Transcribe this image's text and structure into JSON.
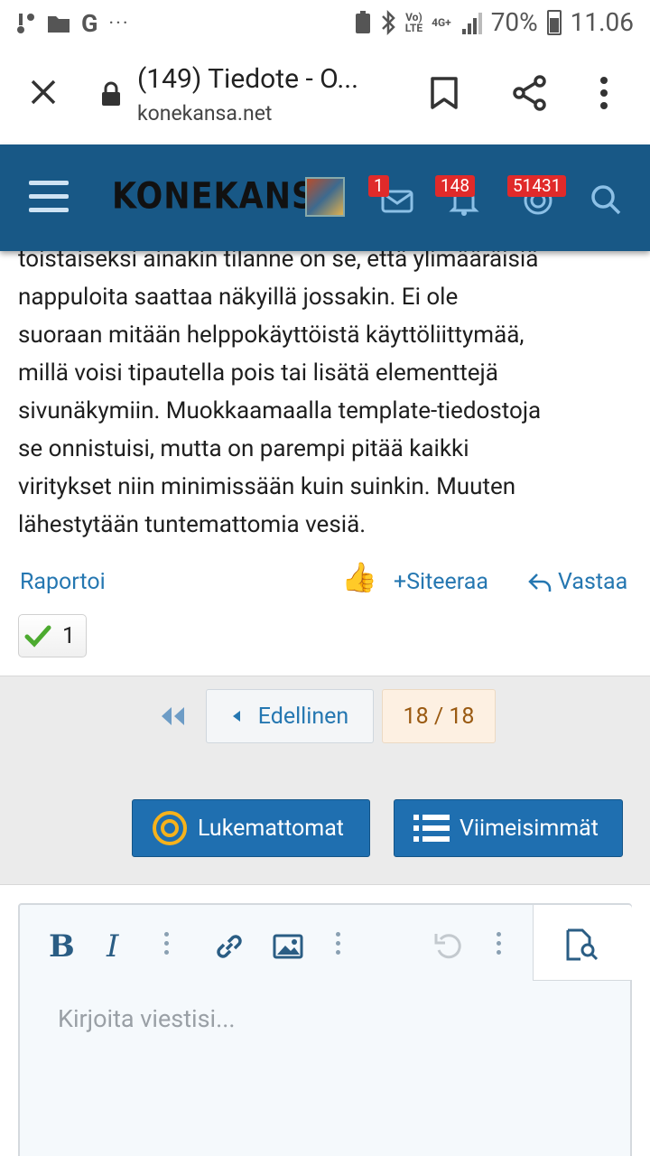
{
  "status_bar": {
    "battery": "70%",
    "time": "11.06",
    "signal_label_top": "Vo)",
    "signal_label_bottom": "LTE",
    "network": "4G+"
  },
  "browser": {
    "tab_title": "(149) Tiedote - O...",
    "url": "konekansa.net"
  },
  "header": {
    "logo": "KONEKANSA",
    "messages_badge": "1",
    "alerts_badge": "148",
    "unread_badge": "51431"
  },
  "post": {
    "partial_top_line": "toistaiseksi ainakin tilanne on se, että ylimääräisiä",
    "lines": [
      "nappuloita saattaa näkyillä jossakin. Ei ole",
      "suoraan mitään helppokäyttöistä käyttöliittymää,",
      "millä voisi tipautella pois tai lisätä elementtejä",
      "sivunäkymiin. Muokkaamaalla template-tiedostoja",
      "se onnistuisi, mutta on parempi pitää kaikki",
      "viritykset niin minimissään kuin suinkin. Muuten",
      "lähestytään tuntemattomia vesiä."
    ],
    "report_label": "Raportoi",
    "quote_label": "Siteeraa",
    "reply_label": "Vastaa",
    "reaction_count": "1"
  },
  "pagination": {
    "prev_label": "Edellinen",
    "current": "18 / 18"
  },
  "buttons": {
    "unread_label": "Lukemattomat",
    "latest_label": "Viimeisimmät"
  },
  "editor": {
    "placeholder": "Kirjoita viestisi...",
    "bold": "B",
    "italic": "I"
  },
  "colors": {
    "header_bg": "#185886",
    "link": "#2577b1",
    "badge": "#e02a2a",
    "button": "#1f6fb0"
  }
}
